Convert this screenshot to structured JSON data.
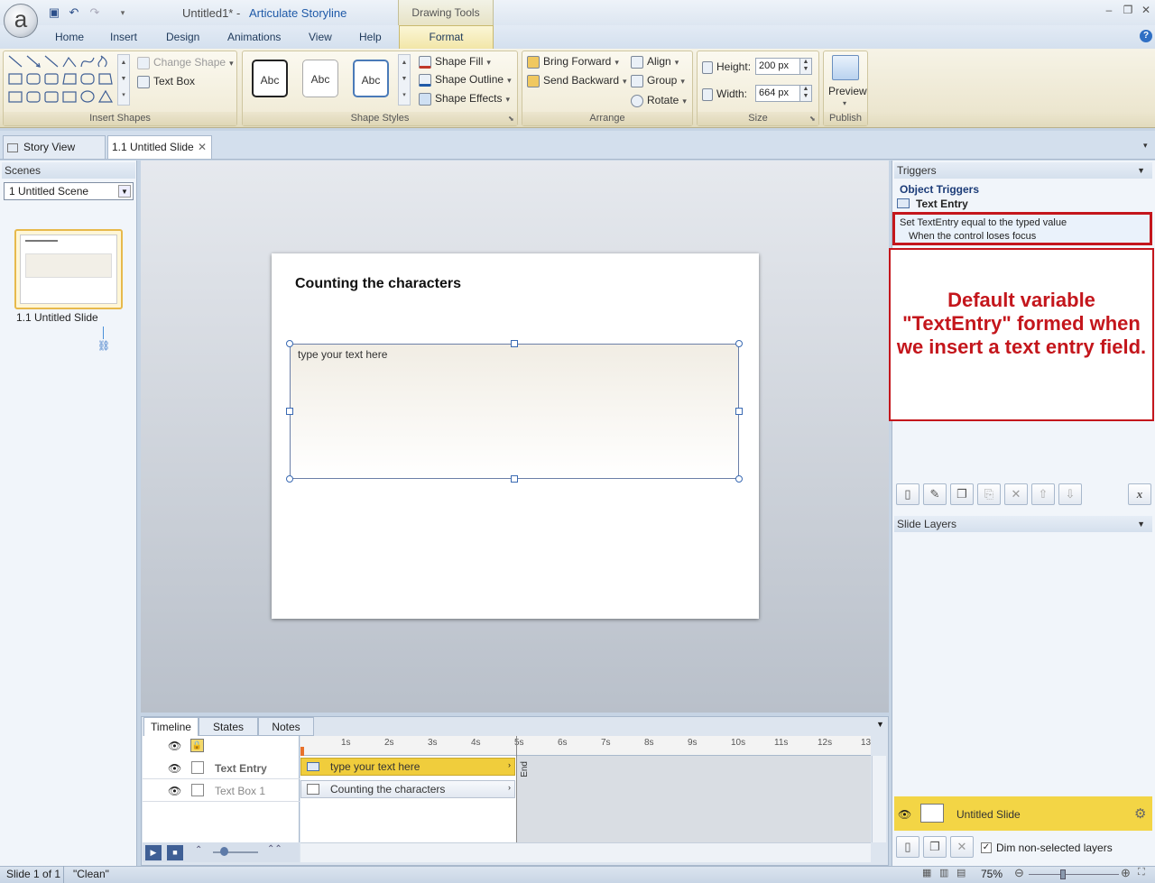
{
  "window": {
    "doc_title": "Untitled1* -",
    "app_name": "Articulate Storyline",
    "context_tab_group": "Drawing Tools"
  },
  "ribbon_tabs": [
    "Home",
    "Insert",
    "Design",
    "Animations",
    "View",
    "Help",
    "Format"
  ],
  "ribbon": {
    "insert_shapes": {
      "change_shape": "Change Shape",
      "text_box": "Text Box",
      "label": "Insert Shapes"
    },
    "shape_styles": {
      "style_sample": "Abc",
      "shape_fill": "Shape Fill",
      "shape_outline": "Shape Outline",
      "shape_effects": "Shape Effects",
      "label": "Shape Styles"
    },
    "arrange": {
      "bring_forward": "Bring Forward",
      "send_backward": "Send Backward",
      "align": "Align",
      "group": "Group",
      "rotate": "Rotate",
      "label": "Arrange"
    },
    "size": {
      "height_label": "Height:",
      "height_value": "200 px",
      "width_label": "Width:",
      "width_value": "664 px",
      "label": "Size"
    },
    "publish": {
      "preview": "Preview",
      "label": "Publish"
    }
  },
  "doc_tabs": {
    "story_view": "Story View",
    "slide_tab": "1.1 Untitled Slide"
  },
  "scenes": {
    "header": "Scenes",
    "selected_scene": "1 Untitled Scene",
    "thumb_label": "1.1 Untitled Slide"
  },
  "slide": {
    "title": "Counting the characters",
    "entry_placeholder": "type your text here"
  },
  "triggers": {
    "header": "Triggers",
    "section": "Object Triggers",
    "object": "Text Entry",
    "line1": "Set TextEntry equal to the typed value",
    "line2": "When the control loses focus"
  },
  "callout": {
    "text": "Default variable \"TextEntry\" formed when we insert a text entry field."
  },
  "slide_layers": {
    "header": "Slide Layers",
    "layer_name": "Untitled Slide",
    "dim_label": "Dim non-selected layers"
  },
  "timeline": {
    "tabs": [
      "Timeline",
      "States",
      "Notes"
    ],
    "ticks": [
      "1s",
      "2s",
      "3s",
      "4s",
      "5s",
      "6s",
      "7s",
      "8s",
      "9s",
      "10s",
      "11s",
      "12s",
      "13"
    ],
    "end_marker": "End",
    "rows": [
      {
        "name": "Text Entry",
        "bar": "type your text here"
      },
      {
        "name": "Text Box 1",
        "bar": "Counting the characters"
      }
    ]
  },
  "status": {
    "slide": "Slide 1 of 1",
    "theme": "\"Clean\"",
    "zoom": "75%"
  },
  "colors": {
    "accent_red": "#c4161c",
    "selection_yellow": "#f3d545",
    "ribbon_format": "#f2e6a8"
  }
}
